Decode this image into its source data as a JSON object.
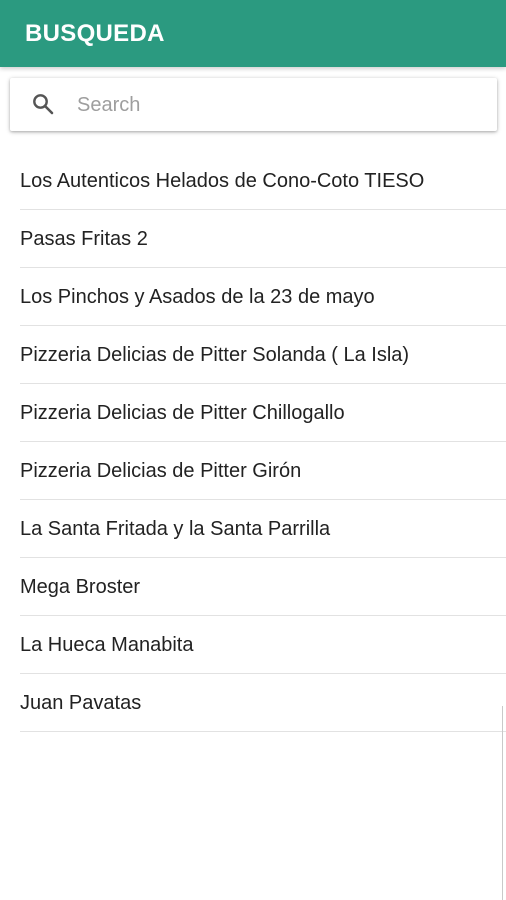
{
  "appbar": {
    "title": "BUSQUEDA",
    "color": "#2b9a80"
  },
  "search": {
    "placeholder": "Search",
    "value": "",
    "icon": "search-icon"
  },
  "results": [
    {
      "label": "Los Autenticos Helados de Cono-Coto TIESO"
    },
    {
      "label": "Pasas Fritas 2"
    },
    {
      "label": "Los Pinchos y Asados de la 23 de mayo"
    },
    {
      "label": "Pizzeria Delicias de Pitter Solanda ( La Isla)"
    },
    {
      "label": "Pizzeria Delicias de Pitter Chillogallo"
    },
    {
      "label": "Pizzeria Delicias de Pitter Girón"
    },
    {
      "label": "La Santa Fritada y la Santa Parrilla"
    },
    {
      "label": "Mega Broster"
    },
    {
      "label": "La Hueca Manabita"
    },
    {
      "label": "Juan Pavatas"
    }
  ]
}
